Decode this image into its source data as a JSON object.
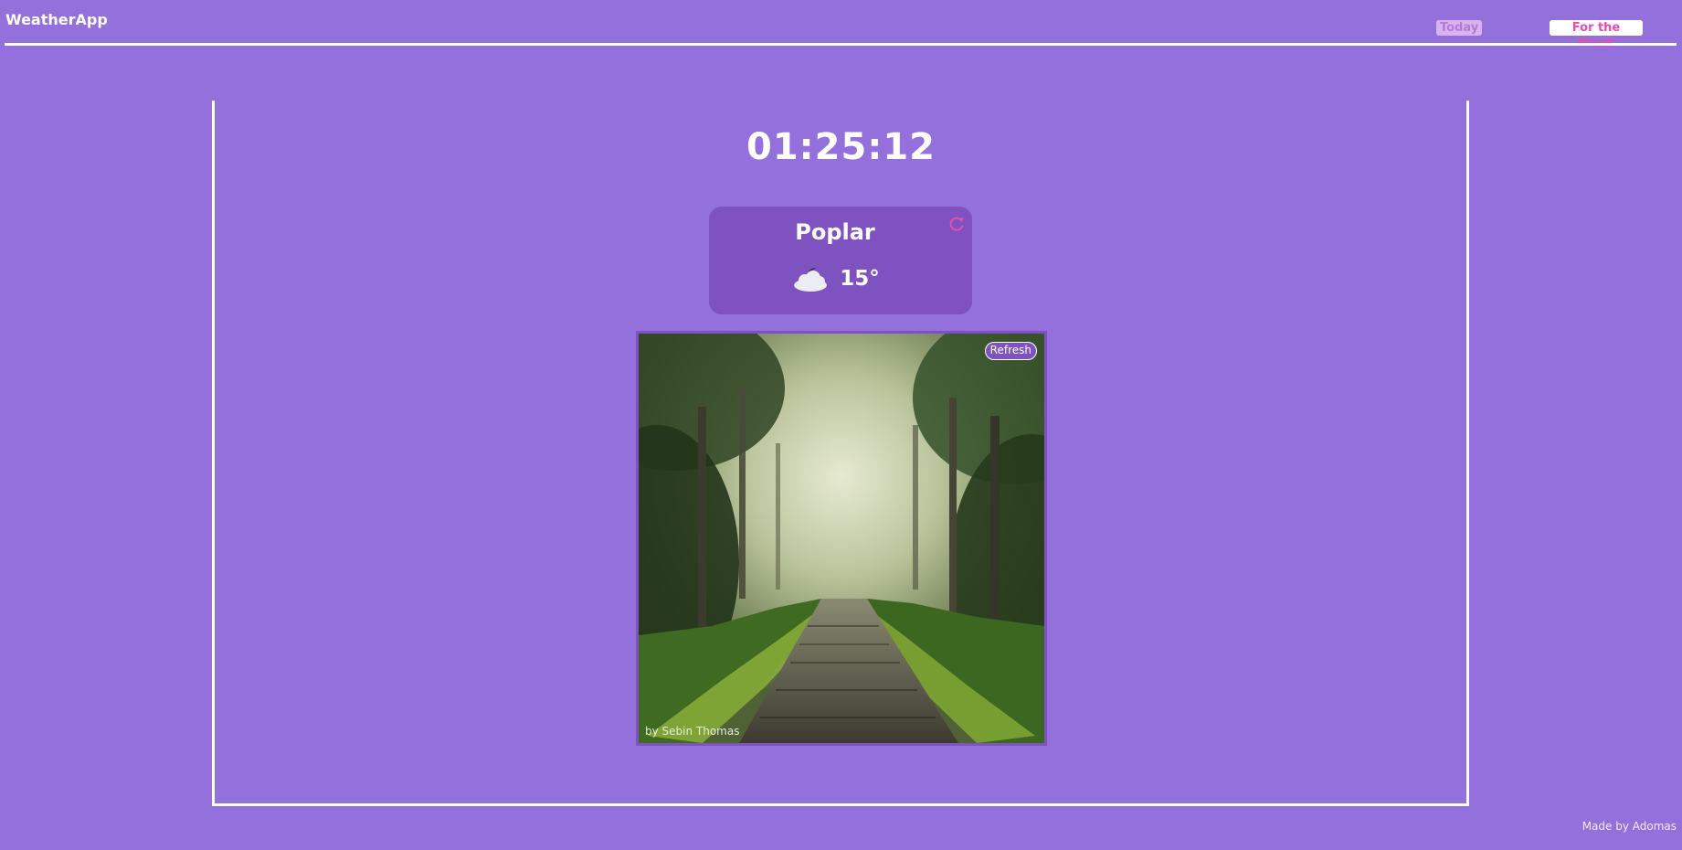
{
  "header": {
    "brand": "WeatherApp",
    "tabs": [
      {
        "label": "Today"
      },
      {
        "label": "For the Week"
      }
    ]
  },
  "clock": {
    "time": "01:25:12"
  },
  "weather": {
    "city": "Poplar",
    "temperature": "15°",
    "condition_icon": "cloud-moon-icon",
    "refresh_icon": "refresh-icon"
  },
  "photo": {
    "refresh_label": "Refresh",
    "credit": "by Sebin Thomas"
  },
  "footer": {
    "text": "Made by Adomas"
  },
  "colors": {
    "background": "#9370db",
    "card": "#7e52c0",
    "accent_pink": "#e64db4",
    "text": "#ffffff"
  }
}
